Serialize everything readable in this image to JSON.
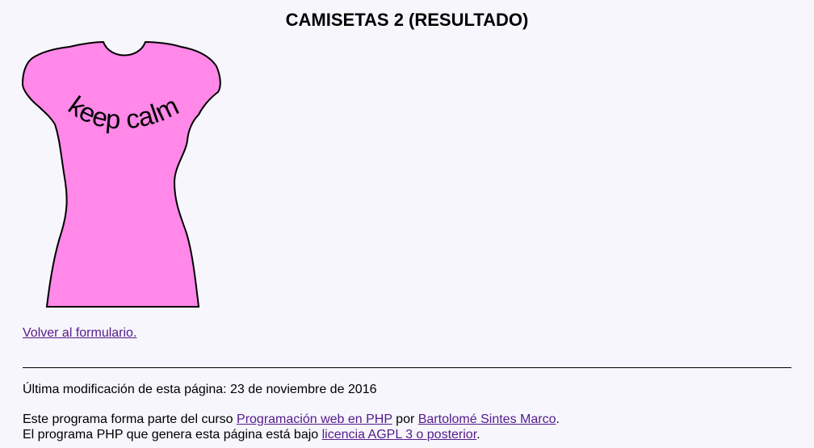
{
  "header": {
    "title": "CAMISETAS 2 (RESULTADO)"
  },
  "shirt": {
    "text": "keep calm",
    "body_color": "#ff88e8",
    "outline_color": "#000000",
    "text_color": "#000000"
  },
  "nav": {
    "back_label": "Volver al formulario."
  },
  "footer": {
    "last_modified_prefix": "Última modificación de esta página: ",
    "last_modified_date": "23 de noviembre de 2016",
    "course_prefix": "Este programa forma parte del curso ",
    "course_link": "Programación web en PHP",
    "course_middle": " por ",
    "author_link": "Bartolomé Sintes Marco",
    "course_suffix": ".",
    "license_prefix": "El programa PHP que genera esta página está bajo ",
    "license_link": "licencia AGPL 3 o posterior",
    "license_suffix": "."
  },
  "colors": {
    "background": "#f6f6fc",
    "link": "#551a8b"
  }
}
